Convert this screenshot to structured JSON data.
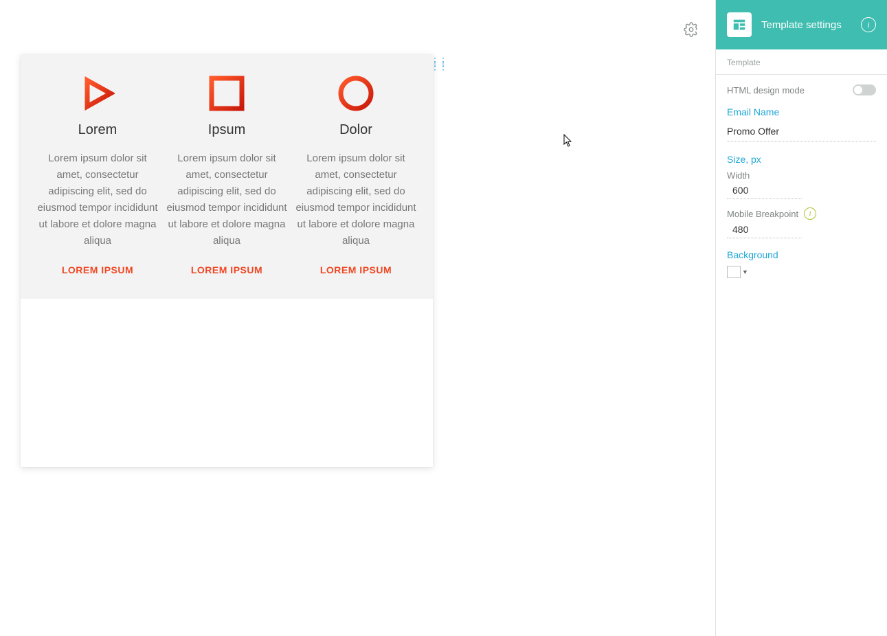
{
  "canvas": {
    "columns": [
      {
        "icon": "play",
        "title": "Lorem",
        "text": "Lorem ipsum dolor sit amet, consectetur adipiscing elit, sed do eiusmod tempor incididunt ut labore et dolore magna aliqua",
        "link": "LOREM IPSUM"
      },
      {
        "icon": "square",
        "title": "Ipsum",
        "text": "Lorem ipsum dolor sit amet, consectetur adipiscing elit, sed do eiusmod tempor incididunt ut labore et dolore magna aliqua",
        "link": "LOREM IPSUM"
      },
      {
        "icon": "circle",
        "title": "Dolor",
        "text": "Lorem ipsum dolor sit amet, consectetur adipiscing elit, sed do eiusmod tempor incididunt ut labore et dolore magna aliqua",
        "link": "LOREM IPSUM"
      }
    ]
  },
  "panel": {
    "header_title": "Template settings",
    "section_label": "Template",
    "html_mode_label": "HTML design mode",
    "email_name_label": "Email Name",
    "email_name_value": "Promo Offer",
    "size_label": "Size, px",
    "width_label": "Width",
    "width_value": "600",
    "breakpoint_label": "Mobile Breakpoint",
    "breakpoint_value": "480",
    "background_label": "Background",
    "background_color": "#ffffff"
  }
}
